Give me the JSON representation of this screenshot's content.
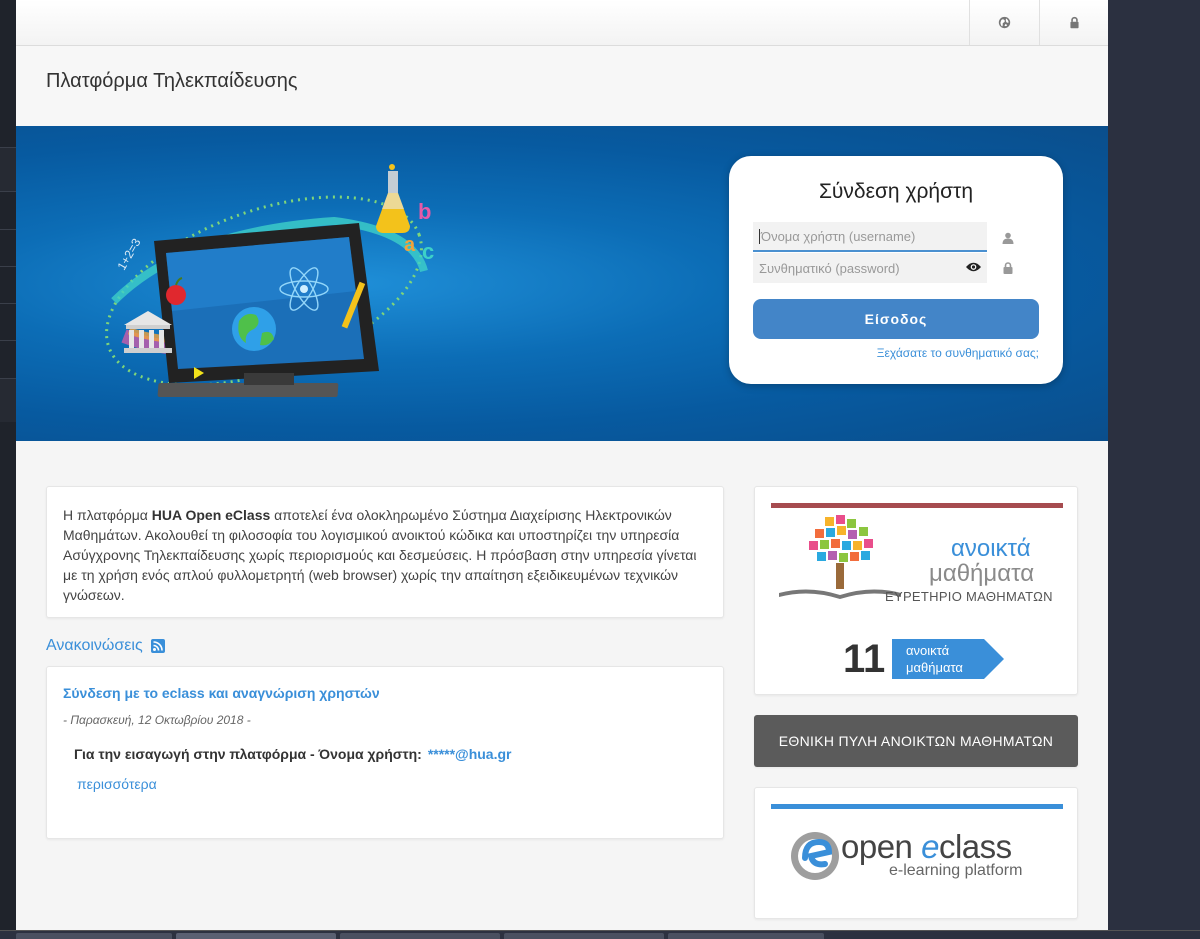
{
  "topbar": {
    "language_icon": "globe-icon",
    "login_icon": "lock-icon"
  },
  "header": {
    "title": "Πλατφόρμα Τηλεκπαίδευσης"
  },
  "login": {
    "title": "Σύνδεση χρήστη",
    "username_placeholder": "Όνομα χρήστη (username)",
    "password_placeholder": "Συνθηματικό (password)",
    "submit_label": "Είσοδος",
    "forgot_link": "Ξεχάσατε το συνθηματικό σας;"
  },
  "intro": {
    "part1": "Η πλατφόρμα ",
    "brand": "HUA Open eClass",
    "part2": " αποτελεί ένα ολοκληρωμένο Σύστημα Διαχείρισης Ηλεκτρονικών Μαθημάτων. Ακολουθεί τη φιλοσοφία του λογισμικού ανοικτού κώδικα και υποστηρίζει την υπηρεσία Ασύγχρονης Τηλεκπαίδευσης χωρίς περιορισμούς και δεσμεύσεις. Η πρόσβαση στην υπηρεσία γίνεται με τη χρήση ενός απλού φυλλομετρητή (web browser) χωρίς την απαίτηση εξειδικευμένων τεχνικών γνώσεων."
  },
  "announcements": {
    "heading": "Ανακοινώσεις",
    "items": [
      {
        "title": "Σύνδεση με το eclass και αναγνώριση χρηστών",
        "date": "- Παρασκευή, 12 Οκτωβρίου 2018 -",
        "body": "Για την εισαγωγή στην πλατφόρμα - Όνομα χρήστη:",
        "highlight": "*****@hua.gr",
        "more": "περισσότερα"
      }
    ]
  },
  "open_courses": {
    "title": "ανοικτά",
    "subtitle": "μαθήματα",
    "index": "ΕΥΡΕΤΗΡΙΟ ΜΑΘΗΜΑΤΩΝ",
    "count": "11",
    "count_label_1": "ανοικτά",
    "count_label_2": "μαθήματα"
  },
  "national_portal": {
    "label": "ΕΘΝΙΚΗ ΠΥΛΗ ΑΝΟΙΚΤΩΝ ΜΑΘΗΜΑΤΩΝ"
  },
  "open_eclass": {
    "main_pre": "open ",
    "main_e": "e",
    "main_post": "class",
    "sub": "e-learning platform"
  },
  "colors": {
    "accent": "#3a8fd9",
    "button": "#4385c8",
    "open_courses_bar": "#a64b4f",
    "portal_bg": "#5b5b5b"
  }
}
